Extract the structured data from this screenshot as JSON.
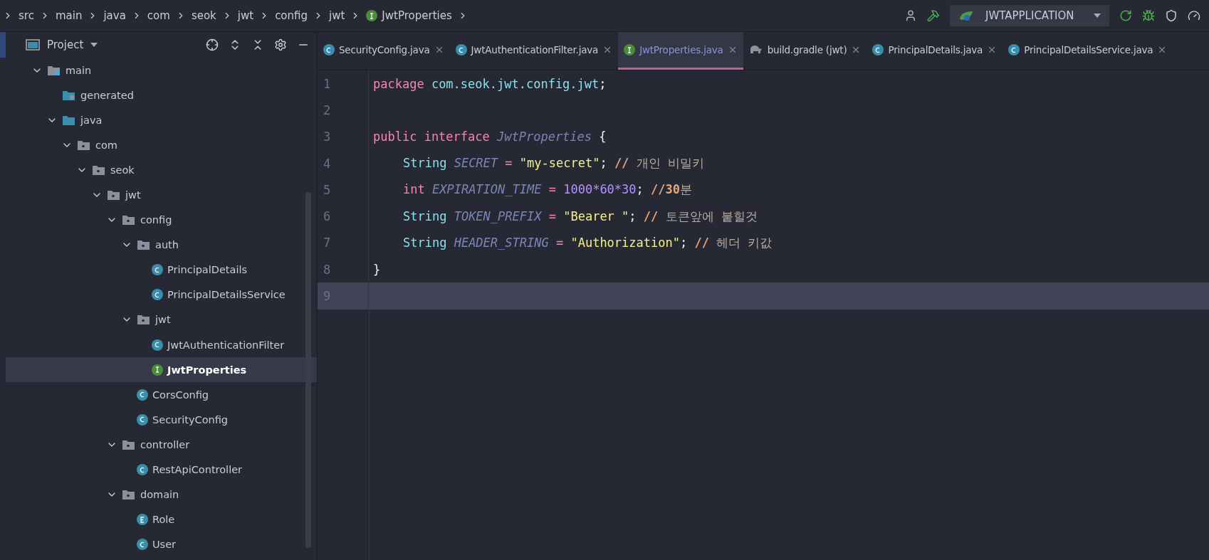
{
  "breadcrumbs": [
    {
      "label": "src"
    },
    {
      "label": "main"
    },
    {
      "label": "java"
    },
    {
      "label": "com"
    },
    {
      "label": "seok"
    },
    {
      "label": "jwt"
    },
    {
      "label": "config"
    },
    {
      "label": "jwt"
    },
    {
      "label": "JwtProperties",
      "kind": "interface"
    }
  ],
  "run_config": {
    "label": "JWTAPPLICATION"
  },
  "project_panel": {
    "title": "Project"
  },
  "tree": [
    {
      "label": "main",
      "kind": "source-root",
      "expanded": true,
      "selected": false,
      "children": [
        {
          "label": "generated",
          "kind": "generated",
          "selected": false
        },
        {
          "label": "java",
          "kind": "source-folder",
          "expanded": true,
          "selected": false,
          "children": [
            {
              "label": "com",
              "kind": "package",
              "expanded": true,
              "selected": false,
              "children": [
                {
                  "label": "seok",
                  "kind": "package",
                  "expanded": true,
                  "selected": false,
                  "children": [
                    {
                      "label": "jwt",
                      "kind": "package",
                      "expanded": true,
                      "selected": false,
                      "children": [
                        {
                          "label": "config",
                          "kind": "package",
                          "expanded": true,
                          "selected": false,
                          "children": [
                            {
                              "label": "auth",
                              "kind": "package",
                              "expanded": true,
                              "selected": false,
                              "children": [
                                {
                                  "label": "PrincipalDetails",
                                  "kind": "class",
                                  "selected": false
                                },
                                {
                                  "label": "PrincipalDetailsService",
                                  "kind": "class",
                                  "selected": false
                                }
                              ]
                            },
                            {
                              "label": "jwt",
                              "kind": "package",
                              "expanded": true,
                              "selected": false,
                              "children": [
                                {
                                  "label": "JwtAuthenticationFilter",
                                  "kind": "class",
                                  "selected": false
                                },
                                {
                                  "label": "JwtProperties",
                                  "kind": "interface",
                                  "selected": true
                                }
                              ]
                            },
                            {
                              "label": "CorsConfig",
                              "kind": "class",
                              "selected": false
                            },
                            {
                              "label": "SecurityConfig",
                              "kind": "class",
                              "selected": false
                            }
                          ]
                        },
                        {
                          "label": "controller",
                          "kind": "package",
                          "expanded": true,
                          "selected": false,
                          "children": [
                            {
                              "label": "RestApiController",
                              "kind": "class",
                              "selected": false
                            }
                          ]
                        },
                        {
                          "label": "domain",
                          "kind": "package",
                          "expanded": true,
                          "selected": false,
                          "children": [
                            {
                              "label": "Role",
                              "kind": "enum",
                              "selected": false
                            },
                            {
                              "label": "User",
                              "kind": "class",
                              "selected": false
                            }
                          ]
                        }
                      ]
                    }
                  ]
                }
              ]
            }
          ]
        }
      ]
    }
  ],
  "tabs": [
    {
      "label": "SecurityConfig.java",
      "kind": "class",
      "selected": false
    },
    {
      "label": "JwtAuthenticationFilter.java",
      "kind": "class",
      "selected": false
    },
    {
      "label": "JwtProperties.java",
      "kind": "interface",
      "selected": true
    },
    {
      "label": "build.gradle (jwt)",
      "kind": "gradle",
      "selected": false
    },
    {
      "label": "PrincipalDetails.java",
      "kind": "class",
      "selected": false
    },
    {
      "label": "PrincipalDetailsService.java",
      "kind": "class",
      "selected": false
    }
  ],
  "editor": {
    "lines": [
      {
        "number": "1",
        "current": false,
        "tokens": [
          {
            "text": "package",
            "kind": "keyword"
          },
          {
            "text": " com.seok.jwt.config.jwt",
            "kind": "package"
          },
          {
            "text": ";",
            "kind": "plain"
          }
        ]
      },
      {
        "number": "2",
        "current": false
      },
      {
        "number": "3",
        "current": false,
        "tokens": [
          {
            "text": "public interface",
            "kind": "keyword"
          },
          {
            "text": " JwtProperties",
            "kind": "name"
          },
          {
            "text": " {",
            "kind": "plain"
          }
        ],
        "children": [
          {
            "number": "4",
            "current": false,
            "tokens": [
              {
                "text": "String",
                "kind": "type"
              },
              {
                "text": " SECRET",
                "kind": "name"
              },
              {
                "text": " =",
                "kind": "operator"
              },
              {
                "text": " \"my-secret\"",
                "kind": "string"
              },
              {
                "text": ";",
                "kind": "plain"
              },
              {
                "text": " //",
                "kind": "comment-mark"
              },
              {
                "text": " 개인 비밀키",
                "kind": "comment"
              }
            ]
          },
          {
            "number": "5",
            "current": false,
            "tokens": [
              {
                "text": "int",
                "kind": "keyword"
              },
              {
                "text": " EXPIRATION_TIME",
                "kind": "name"
              },
              {
                "text": " =",
                "kind": "operator"
              },
              {
                "text": " 1000*60*30",
                "kind": "number"
              },
              {
                "text": ";",
                "kind": "plain"
              },
              {
                "text": " //",
                "kind": "comment-mark"
              },
              {
                "text": "30",
                "kind": "comment-bold"
              },
              {
                "text": "분",
                "kind": "comment"
              }
            ]
          },
          {
            "number": "6",
            "current": false,
            "tokens": [
              {
                "text": "String",
                "kind": "type"
              },
              {
                "text": " TOKEN_PREFIX",
                "kind": "name"
              },
              {
                "text": " =",
                "kind": "operator"
              },
              {
                "text": " \"Bearer \"",
                "kind": "string"
              },
              {
                "text": ";",
                "kind": "plain"
              },
              {
                "text": " //",
                "kind": "comment-mark"
              },
              {
                "text": " 토큰앞에 붙힐것",
                "kind": "comment"
              }
            ]
          },
          {
            "number": "7",
            "current": false,
            "tokens": [
              {
                "text": "String",
                "kind": "type"
              },
              {
                "text": " HEADER_STRING",
                "kind": "name"
              },
              {
                "text": " =",
                "kind": "operator"
              },
              {
                "text": " \"Authorization\"",
                "kind": "string"
              },
              {
                "text": ";",
                "kind": "plain"
              },
              {
                "text": " //",
                "kind": "comment-mark"
              },
              {
                "text": " 헤더 키값",
                "kind": "comment"
              }
            ]
          }
        ]
      },
      {
        "number": "8",
        "current": false,
        "tokens": [
          {
            "text": "}",
            "kind": "plain"
          }
        ]
      },
      {
        "number": "9",
        "current": true
      }
    ]
  }
}
